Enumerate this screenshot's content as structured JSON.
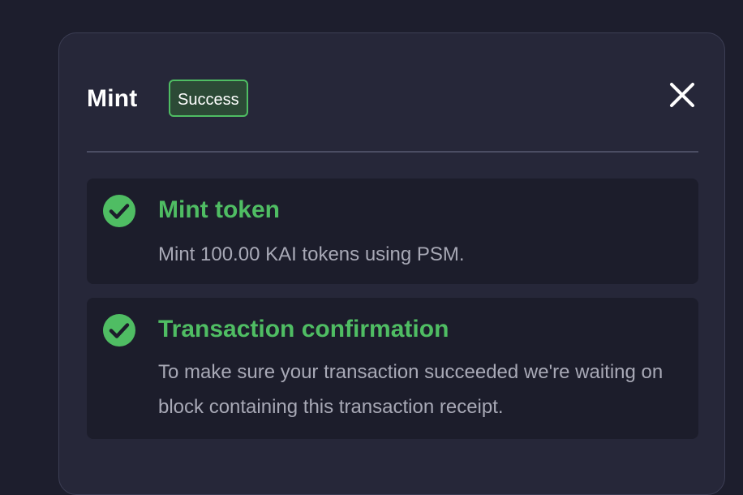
{
  "modal": {
    "title": "Mint",
    "status_badge": "Success",
    "close_icon": "close-icon",
    "colors": {
      "success": "#4fbd63",
      "background": "#262739",
      "step_background": "#1c1d2b"
    }
  },
  "steps": [
    {
      "icon": "check-circle-icon",
      "title": "Mint token",
      "description": "Mint 100.00 KAI tokens using PSM."
    },
    {
      "icon": "check-circle-icon",
      "title": "Transaction confirmation",
      "description": "To make sure your transaction succeeded we're waiting on block containing this transaction receipt."
    }
  ]
}
